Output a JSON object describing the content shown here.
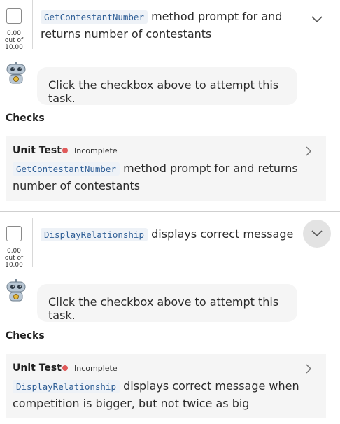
{
  "tasks": [
    {
      "code": "GetContestantNumber",
      "title_rest": " method prompt for and returns number of contestants",
      "score": "0.00",
      "score_of": "out of",
      "score_max": "10.00",
      "hint": "Click the checkbox above to attempt this task.",
      "checks_label": "Checks",
      "check": {
        "type": "Unit Test",
        "status": "Incomplete",
        "code": "GetContestantNumber",
        "desc_rest": " method prompt for and returns number of contestants"
      }
    },
    {
      "code": "DisplayRelationship",
      "title_rest": " displays correct message",
      "score": "0.00",
      "score_of": "out of",
      "score_max": "10.00",
      "hint": "Click the checkbox above to attempt this task.",
      "checks_label": "Checks",
      "check": {
        "type": "Unit Test",
        "status": "Incomplete",
        "code": "DisplayRelationship",
        "desc_rest": " displays correct message when competition is bigger, but not twice as big"
      }
    }
  ],
  "colors": {
    "status_incomplete": "#e05a5a",
    "code_text": "#2d5d95",
    "card_bg": "#f5f5f5"
  },
  "icons": {
    "assistant": "robot-icon",
    "expand": "chevron-down-icon",
    "open_check": "chevron-right-icon"
  }
}
